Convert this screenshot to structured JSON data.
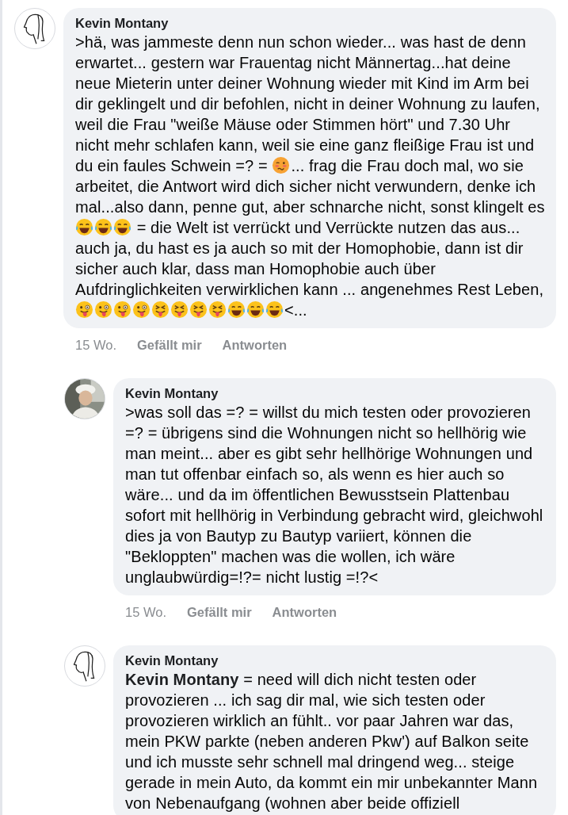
{
  "comments": [
    {
      "author": "Kevin Montany",
      "avatar": {
        "kind": "sketch"
      },
      "reply": false,
      "time": "15 Wo.",
      "actions": [
        "Gefällt mir",
        "Antworten"
      ],
      "segments": [
        {
          "kind": "text",
          "text": ">hä, was jammeste denn nun schon wieder... was hast de denn erwartet... gestern war Frauentag nicht Männertag...hat deine neue Mieterin unter deiner Wohnung wieder mit Kind im Arm bei dir geklingelt und dir befohlen, nicht in deiner Wohnung zu laufen, weil die Frau \"weiße Mäuse oder Stimmen hört\" und 7.30 Uhr nicht mehr schlafen kann, weil sie eine ganz fleißige Frau ist und du ein faules Schwein =? = "
        },
        {
          "kind": "woozy"
        },
        {
          "kind": "text",
          "text": "... frag die Frau doch mal, wo sie arbeitet, die Antwort wird dich sicher nicht verwundern, denke ich mal...also dann, penne gut, aber schnarche nicht, sonst klingelt es "
        },
        {
          "kind": "laugh"
        },
        {
          "kind": "laugh"
        },
        {
          "kind": "laugh"
        },
        {
          "kind": "text",
          "text": " = die Welt ist verrückt und Verrückte nutzen das aus... auch ja, du hast es ja auch so mit der Homophobie, dann ist dir sicher auch klar, dass man Homophobie  auch über Aufdringlichkeiten verwirklichen kann  ... angenehmes Rest Leben, "
        },
        {
          "kind": "tongue"
        },
        {
          "kind": "tongue"
        },
        {
          "kind": "tongue"
        },
        {
          "kind": "tongue"
        },
        {
          "kind": "squint"
        },
        {
          "kind": "squint"
        },
        {
          "kind": "squint"
        },
        {
          "kind": "squint"
        },
        {
          "kind": "laugh"
        },
        {
          "kind": "laugh"
        },
        {
          "kind": "laugh"
        },
        {
          "kind": "text",
          "text": "<..."
        }
      ]
    },
    {
      "author": "Kevin Montany",
      "avatar": {
        "kind": "picture"
      },
      "reply": true,
      "time": "15 Wo.",
      "actions": [
        "Gefällt mir",
        "Antworten"
      ],
      "segments": [
        {
          "kind": "text",
          "text": ">was soll das =? = willst du mich testen oder provozieren =? = übrigens sind die Wohnungen nicht so hellhörig wie man meint... aber es gibt sehr hellhörige Wohnungen und man tut offenbar einfach so, als wenn es hier auch so wäre... und da im öffentlichen Bewusstsein Plattenbau sofort mit hellhörig in Verbindung gebracht wird, gleichwohl dies ja von Bautyp zu Bautyp variiert, können die \"Bekloppten\" machen was die wollen, ich wäre unglaubwürdig=!?= nicht lustig =!?<"
        }
      ]
    },
    {
      "author": "Kevin Montany",
      "avatar": {
        "kind": "sketch"
      },
      "reply": true,
      "segments": [
        {
          "kind": "text",
          "text": "**Kevin Montany** = need will dich nicht testen oder provozieren ... ich sag dir mal, wie sich testen oder provozieren wirklich an fühlt.. vor paar Jahren war das, mein PKW parkte (neben anderen Pkw') auf Balkon seite und ich musste sehr schnell mal dringend weg... steige gerade in mein Auto, da kommt ein mir unbekannter Mann von Nebenaufgang (wohnen aber beide offiziell"
        }
      ]
    }
  ]
}
